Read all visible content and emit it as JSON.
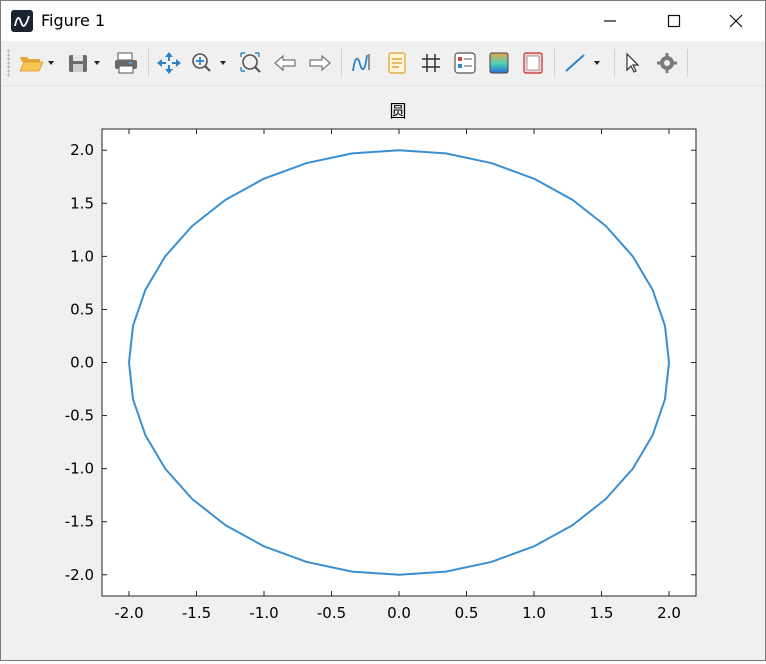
{
  "window": {
    "title": "Figure 1",
    "app_icon": "octave-logo-icon",
    "controls": [
      "minimize-icon",
      "maximize-icon",
      "close-icon"
    ]
  },
  "toolbar": {
    "buttons": [
      {
        "name": "open-file",
        "icon": "folder-open-icon",
        "has_dropdown": true
      },
      {
        "name": "save",
        "icon": "floppy-disk-icon",
        "has_dropdown": true
      },
      {
        "name": "print",
        "icon": "printer-icon"
      },
      {
        "name": "pan",
        "icon": "pan-arrows-icon"
      },
      {
        "name": "zoom-in",
        "icon": "zoom-in-icon",
        "has_dropdown": true
      },
      {
        "name": "zoom-fit",
        "icon": "zoom-fit-icon"
      },
      {
        "name": "back",
        "icon": "arrow-left-icon"
      },
      {
        "name": "forward",
        "icon": "arrow-right-icon"
      },
      {
        "name": "rotate",
        "icon": "rotate-icon"
      },
      {
        "name": "insert-text",
        "icon": "text-note-icon"
      },
      {
        "name": "grid",
        "icon": "grid-icon"
      },
      {
        "name": "legend",
        "icon": "legend-icon"
      },
      {
        "name": "colorbar",
        "icon": "colorbar-icon"
      },
      {
        "name": "axes",
        "icon": "axes-box-icon"
      },
      {
        "name": "line",
        "icon": "line-draw-icon",
        "has_dropdown": true
      },
      {
        "name": "select",
        "icon": "cursor-arrow-icon"
      },
      {
        "name": "settings",
        "icon": "gear-icon"
      }
    ]
  },
  "chart_data": {
    "type": "line",
    "title": "圆",
    "xlabel": "",
    "ylabel": "",
    "xlim": [
      -2.2,
      2.2
    ],
    "ylim": [
      -2.2,
      2.2
    ],
    "x_ticks": [
      -2.0,
      -1.5,
      -1.0,
      -0.5,
      0.0,
      0.5,
      1.0,
      1.5,
      2.0
    ],
    "y_ticks": [
      -2.0,
      -1.5,
      -1.0,
      -0.5,
      0.0,
      0.5,
      1.0,
      1.5,
      2.0
    ],
    "x_tick_labels": [
      "-2.0",
      "-1.5",
      "-1.0",
      "-0.5",
      "0.0",
      "0.5",
      "1.0",
      "1.5",
      "2.0"
    ],
    "y_tick_labels": [
      "-2.0",
      "-1.5",
      "-1.0",
      "-0.5",
      "0.0",
      "0.5",
      "1.0",
      "1.5",
      "2.0"
    ],
    "grid": false,
    "series": [
      {
        "color": "#3a8fd3",
        "x": [
          2.0,
          1.97,
          1.879,
          1.732,
          1.532,
          1.286,
          1.0,
          0.684,
          0.347,
          0.0,
          -0.347,
          -0.684,
          -1.0,
          -1.286,
          -1.532,
          -1.732,
          -1.879,
          -1.97,
          -2.0,
          -1.97,
          -1.879,
          -1.732,
          -1.532,
          -1.286,
          -1.0,
          -0.684,
          -0.347,
          0.0,
          0.347,
          0.684,
          1.0,
          1.286,
          1.532,
          1.732,
          1.879,
          1.97,
          2.0
        ],
        "y": [
          0.0,
          0.347,
          0.684,
          1.0,
          1.286,
          1.532,
          1.732,
          1.879,
          1.97,
          2.0,
          1.97,
          1.879,
          1.732,
          1.532,
          1.286,
          1.0,
          0.684,
          0.347,
          0.0,
          -0.347,
          -0.684,
          -1.0,
          -1.286,
          -1.532,
          -1.732,
          -1.879,
          -1.97,
          -2.0,
          -1.97,
          -1.879,
          -1.732,
          -1.532,
          -1.286,
          -1.0,
          -0.684,
          -0.347,
          0.0
        ]
      }
    ]
  }
}
